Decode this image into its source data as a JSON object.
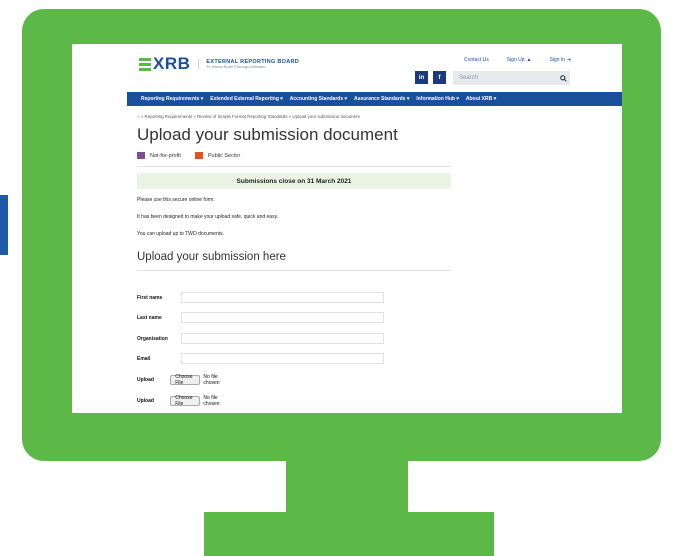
{
  "header": {
    "logo_mark": "XRB",
    "logo_title": "EXTERNAL REPORTING BOARD",
    "logo_subtitle": "Te Kāwai Ārahi Pūrongo Mōwaho",
    "links": {
      "contact": "Contact Us",
      "signup": "Sign Up",
      "signin": "Sign In"
    },
    "social": {
      "linkedin": "in",
      "facebook": "f"
    },
    "search_placeholder": "Search"
  },
  "nav": [
    "Reporting Requirements ▾",
    "Extended External Reporting ▾",
    "Accounting Standards ▾",
    "Assurance Standards ▾",
    "Information Hub ▾",
    "About XRB ▾"
  ],
  "breadcrumb": "⌂ » Reporting Requirements » Review of Simple Format Reporting Standards » Upload your submission document",
  "page_title": "Upload your submission document",
  "legend": [
    {
      "label": "Not-for-profit",
      "color": "#7d4f8f"
    },
    {
      "label": "Public Sector",
      "color": "#e2541b"
    }
  ],
  "banner": "Submissions close on 31 March 2021",
  "paragraphs": [
    "Please use this secure online form.",
    "It has been designed to make your upload safe, quick and easy.",
    "You can upload up to TWO documents."
  ],
  "section_title": "Upload your submission here",
  "form": {
    "first_name_label": "First name",
    "last_name_label": "Last name",
    "organisation_label": "Organisation",
    "email_label": "Email",
    "upload_label": "Upload",
    "choose_file": "Choose File",
    "no_file": "No file chosen"
  },
  "colors": {
    "monitor": "#5cb947",
    "brand_blue": "#1a4f9c",
    "banner_bg": "#e9f4e4"
  }
}
